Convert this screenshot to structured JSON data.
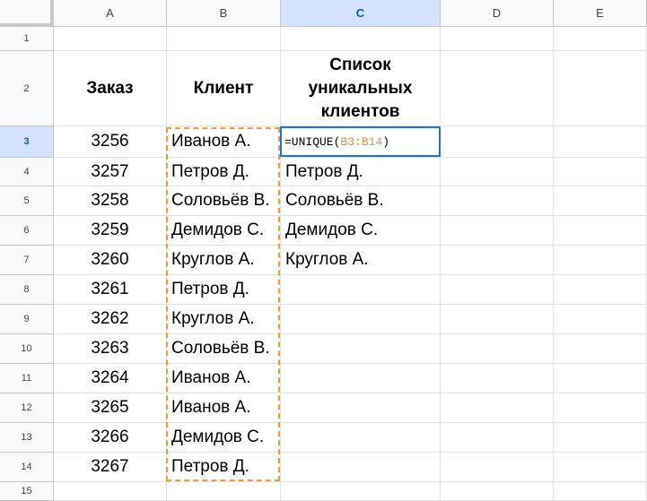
{
  "columns": [
    "A",
    "B",
    "C",
    "D",
    "E"
  ],
  "selected_column": "C",
  "selected_row": 3,
  "headers": {
    "order": "Заказ",
    "client": "Клиент",
    "unique_list": "Список уникальных клиентов"
  },
  "orders": [
    "3256",
    "3257",
    "3258",
    "3259",
    "3260",
    "3261",
    "3262",
    "3263",
    "3264",
    "3265",
    "3266",
    "3267"
  ],
  "clients": [
    "Иванов А.",
    "Петров Д.",
    "Соловьёв В.",
    "Демидов С.",
    "Круглов А.",
    "Петров Д.",
    "Круглов А.",
    "Соловьёв В.",
    "Иванов А.",
    "Иванов А.",
    "Демидов С.",
    "Петров Д."
  ],
  "unique_clients": [
    "Петров Д.",
    "Соловьёв В.",
    "Демидов С.",
    "Круглов А."
  ],
  "formula": {
    "prefix": "=UNIQUE(",
    "range": "B3:B14",
    "suffix": ")"
  },
  "colors": {
    "selection_blue": "#1a73e8",
    "range_orange": "#f29b30",
    "header_selected_bg": "#d3e3fd"
  }
}
